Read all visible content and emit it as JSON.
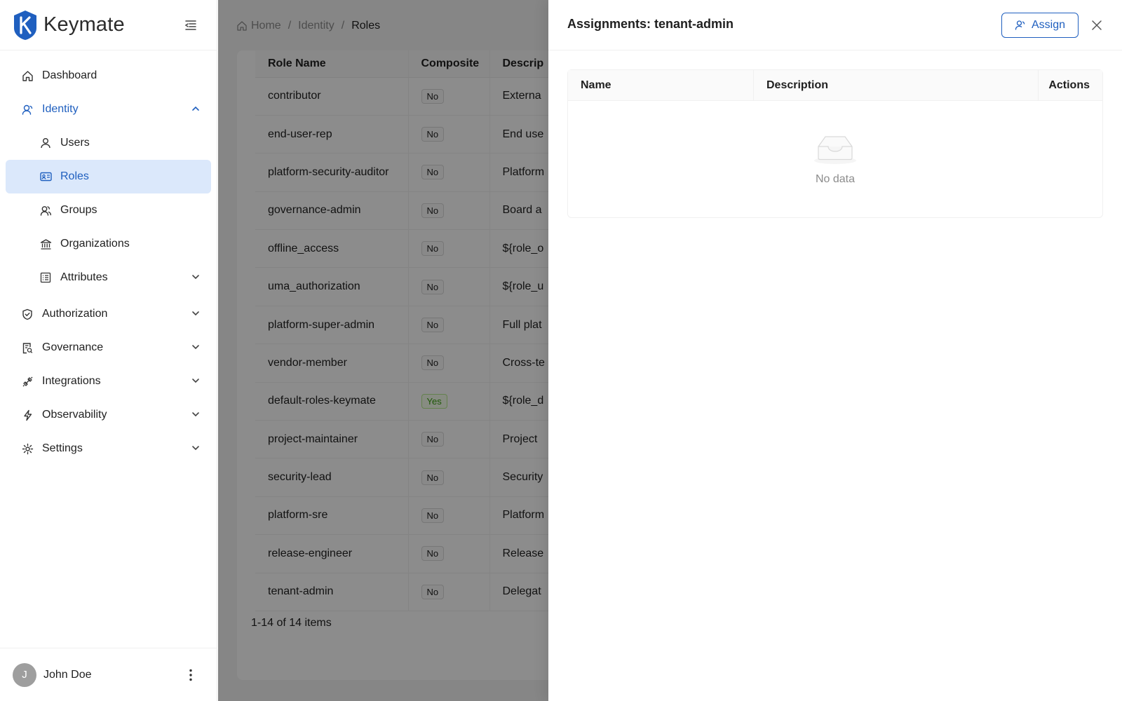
{
  "brand": {
    "name": "Keymate"
  },
  "sidebar": {
    "items": [
      {
        "label": "Dashboard"
      },
      {
        "label": "Identity"
      },
      {
        "label": "Users"
      },
      {
        "label": "Roles"
      },
      {
        "label": "Groups"
      },
      {
        "label": "Organizations"
      },
      {
        "label": "Attributes"
      },
      {
        "label": "Authorization"
      },
      {
        "label": "Governance"
      },
      {
        "label": "Integrations"
      },
      {
        "label": "Observability"
      },
      {
        "label": "Settings"
      }
    ],
    "user": {
      "initial": "J",
      "name": "John Doe"
    }
  },
  "breadcrumb": {
    "home": "Home",
    "sep": "/",
    "identity": "Identity",
    "current": "Roles"
  },
  "roles_table": {
    "headers": {
      "name": "Role Name",
      "composite": "Composite",
      "description": "Descrip"
    },
    "rows": [
      {
        "name": "contributor",
        "composite": "No",
        "description": "Externa"
      },
      {
        "name": "end-user-rep",
        "composite": "No",
        "description": "End use"
      },
      {
        "name": "platform-security-auditor",
        "composite": "No",
        "description": "Platform"
      },
      {
        "name": "governance-admin",
        "composite": "No",
        "description": "Board a"
      },
      {
        "name": "offline_access",
        "composite": "No",
        "description": "${role_o"
      },
      {
        "name": "uma_authorization",
        "composite": "No",
        "description": "${role_u"
      },
      {
        "name": "platform-super-admin",
        "composite": "No",
        "description": "Full plat"
      },
      {
        "name": "vendor-member",
        "composite": "No",
        "description": "Cross-te"
      },
      {
        "name": "default-roles-keymate",
        "composite": "Yes",
        "description": "${role_d"
      },
      {
        "name": "project-maintainer",
        "composite": "No",
        "description": "Project"
      },
      {
        "name": "security-lead",
        "composite": "No",
        "description": "Security"
      },
      {
        "name": "platform-sre",
        "composite": "No",
        "description": "Platform"
      },
      {
        "name": "release-engineer",
        "composite": "No",
        "description": "Release"
      },
      {
        "name": "tenant-admin",
        "composite": "No",
        "description": "Delegat"
      }
    ],
    "total": "1-14 of 14 items"
  },
  "drawer": {
    "title": "Assignments: tenant-admin",
    "assign_label": "Assign",
    "table": {
      "name": "Name",
      "description": "Description",
      "actions": "Actions"
    },
    "empty": "No data"
  },
  "colors": {
    "primary": "#1f5fbf",
    "selected_bg": "#dbe8fb",
    "yes_tag": "#389e0d"
  }
}
